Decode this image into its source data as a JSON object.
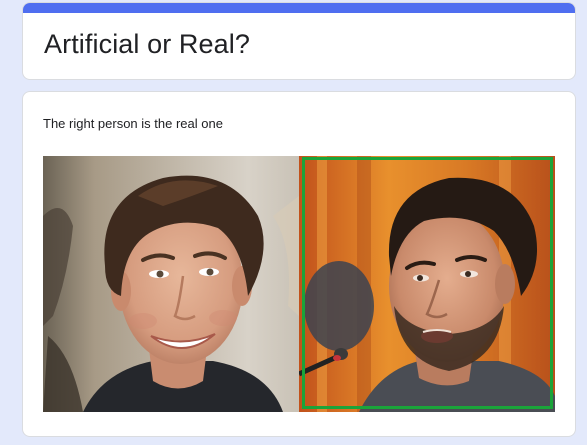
{
  "form": {
    "title": "Artificial or Real?",
    "accent_color": "#4f6ef0"
  },
  "question": {
    "text": "The right person is the real one",
    "highlight_color": "#1aa43a",
    "images": [
      {
        "name": "left-face-photo"
      },
      {
        "name": "right-face-photo"
      }
    ]
  }
}
